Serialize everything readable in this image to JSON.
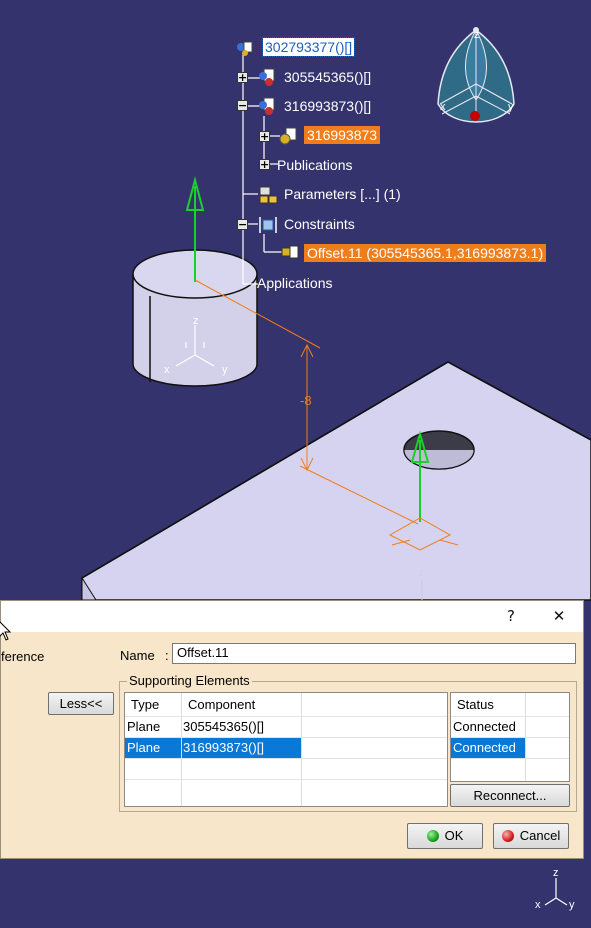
{
  "tree": {
    "root": {
      "label": "302793377()[]"
    },
    "items": [
      {
        "label": "305545365()[]"
      },
      {
        "label": "316993873()[]"
      },
      {
        "label": "316993873"
      },
      {
        "label": "Publications"
      },
      {
        "label": "Parameters [...] (1)"
      },
      {
        "label": "Constraints"
      },
      {
        "label": "Offset.11 (305545365.1,316993873.1)"
      },
      {
        "label": "Applications"
      }
    ]
  },
  "viewport": {
    "dimension_value": "-8",
    "axis_labels": {
      "x": "x",
      "y": "y",
      "z": "z"
    },
    "compass_labels": {
      "x": "x",
      "y": "y",
      "z": "z"
    },
    "corner_axis_labels": {
      "x": "x",
      "y": "y",
      "z": "z"
    }
  },
  "dialog": {
    "help_label": "?",
    "close_label": "✕",
    "left_clipped_label": "ference",
    "name_label": "Name",
    "name_colon": ":",
    "name_value": "Offset.11",
    "less_button": "Less<<",
    "group_title": "Supporting Elements",
    "columns": [
      "Type",
      "Component"
    ],
    "rows": [
      {
        "type": "Plane",
        "component": "305545365()[]"
      },
      {
        "type": "Plane",
        "component": "316993873()[]"
      }
    ],
    "status_header": "Status",
    "status_rows": [
      "Connected",
      "Connected"
    ],
    "reconnect_button": "Reconnect...",
    "ok_button": "OK",
    "cancel_button": "Cancel"
  }
}
